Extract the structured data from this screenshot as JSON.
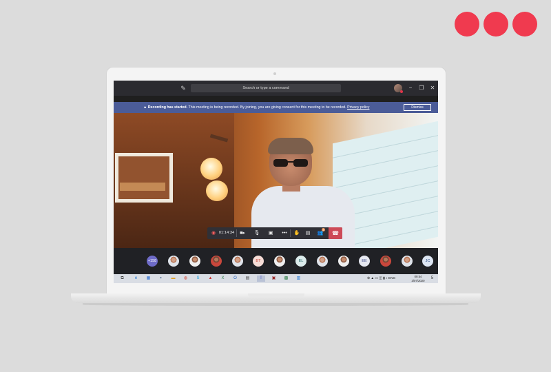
{
  "brand_colors": {
    "accent": "#f03a4f",
    "banner": "#4b5c98",
    "hangup": "#cd4a57"
  },
  "window": {
    "search_placeholder": "Search or type a command",
    "icons": [
      "compose-icon",
      "profile-avatar",
      "minimize-icon",
      "maximize-icon",
      "close-icon"
    ],
    "minimize_glyph": "−",
    "maximize_glyph": "❐",
    "close_glyph": "✕"
  },
  "banner": {
    "icon": "warning-icon",
    "bold": "Recording has started.",
    "message": " This meeting is being recorded. By joining, you are giving consent for this meeting to be recorded. ",
    "link": "Privacy policy",
    "dismiss_label": "Dismiss"
  },
  "controls": {
    "timer": "01:14:34",
    "icons": [
      "record-icon",
      "camera-icon",
      "mic-muted-icon",
      "share-screen-icon",
      "more-options-icon",
      "raise-hand-icon",
      "chat-icon",
      "participants-icon",
      "hang-up-icon"
    ],
    "participants_badge": "4",
    "more_glyph": "•••"
  },
  "participants": {
    "overflow_count": "+158",
    "initials": [
      "BT",
      "EL",
      "EE",
      "JC"
    ]
  },
  "taskbar": {
    "time": "09:54",
    "date": "3/07/2020",
    "notification_count": "5"
  }
}
